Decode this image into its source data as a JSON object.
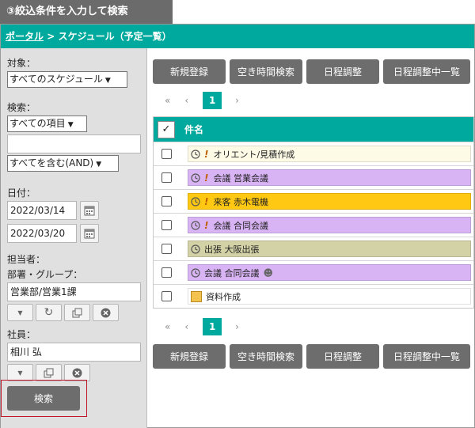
{
  "step_label": "③絞込条件を入力して検索",
  "breadcrumb": {
    "portal": "ポータル",
    "separator": ">",
    "current": "スケジュール（予定一覧）"
  },
  "sidebar": {
    "target_label": "対象：",
    "target_value": "すべてのスケジュール",
    "search_label": "検索：",
    "search_field_value": "すべての項目",
    "search_text": "",
    "match_value": "すべてを含む(AND)",
    "date_label": "日付：",
    "date_from": "2022/03/14",
    "date_to": "2022/03/20",
    "assignee_label": "担当者：",
    "dept_label": "部署・グループ：",
    "dept_value": "営業部/営業1課",
    "employee_label": "社員：",
    "employee_value": "相川 弘",
    "search_button": "検索"
  },
  "toolbar": {
    "new": "新規登録",
    "free_time": "空き時間検索",
    "adjust": "日程調整",
    "adjust_list": "日程調整中一覧"
  },
  "pager": {
    "first": "«",
    "prev": "‹",
    "current": "1",
    "next": "›"
  },
  "table": {
    "header_check": "✓",
    "header_title": "件名",
    "rows": [
      {
        "text": "オリエント/見積作成",
        "bg": "#fdfbe6",
        "clock": true,
        "excl": true,
        "people": false,
        "note": false
      },
      {
        "text": "会議 営業会議",
        "bg": "#d9b4f5",
        "clock": true,
        "excl": true,
        "people": false,
        "note": false
      },
      {
        "text": "来客 赤木電機",
        "bg": "#ffc812",
        "clock": true,
        "excl": true,
        "people": false,
        "note": false
      },
      {
        "text": "会議 合同会議",
        "bg": "#d9b4f5",
        "clock": true,
        "excl": true,
        "people": false,
        "note": false
      },
      {
        "text": "出張 大阪出張",
        "bg": "#d3d1a6",
        "clock": true,
        "excl": false,
        "people": false,
        "note": false
      },
      {
        "text": "会議 合同会議",
        "bg": "#d9b4f5",
        "clock": true,
        "excl": false,
        "people": true,
        "note": false
      },
      {
        "text": "資料作成",
        "bg": "#ffffff",
        "clock": false,
        "excl": false,
        "people": false,
        "note": true
      }
    ]
  },
  "colors": {
    "teal": "#00a99d",
    "button_gray": "#6d6d6d",
    "highlight_red": "#c0152b"
  },
  "icons": {
    "calendar": "calendar-icon",
    "clock": "clock-icon",
    "priority": "exclamation-icon",
    "attendees": "people-icon"
  }
}
